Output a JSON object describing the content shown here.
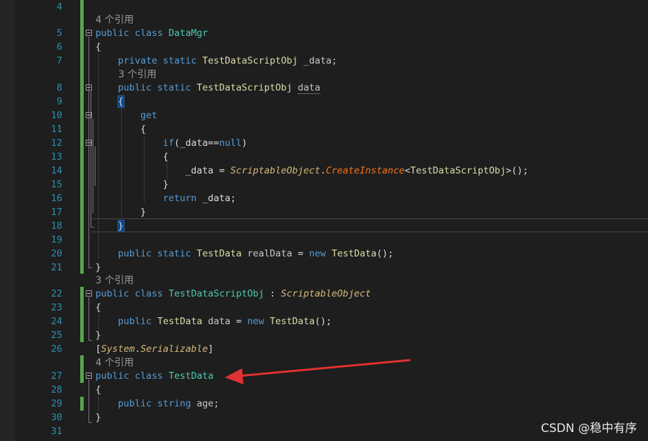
{
  "line_numbers": [
    "4",
    "5",
    "6",
    "7",
    "8",
    "9",
    "10",
    "11",
    "12",
    "13",
    "14",
    "15",
    "16",
    "17",
    "18",
    "19",
    "20",
    "21",
    "22",
    "23",
    "24",
    "25",
    "26",
    "27",
    "28",
    "29",
    "30",
    "31"
  ],
  "lens": {
    "refs_4": "4 个引用",
    "refs_3": "3 个引用"
  },
  "code": {
    "kw_public_class": "public class",
    "dataMgr": "DataMgr",
    "brace_open": "{",
    "brace_close": "}",
    "private_static": "private static",
    "public_static": "public static",
    "testDataScriptObj": "TestDataScriptObj",
    "field_data_decl": "_data;",
    "prop_data": "data",
    "get": "get",
    "if": "if",
    "if_cond_open": "(_data==",
    "null": "null",
    "if_cond_close": ")",
    "assign_data": "_data = ",
    "scriptableObject": "ScriptableObject",
    "dot": ".",
    "createInstance": "CreateInstance",
    "generic_open": "<",
    "generic_close": ">();",
    "return": "return",
    "return_val": "_data;",
    "testData": "TestData",
    "realData": "realData",
    "eq": " = ",
    "new": "new",
    "ctor_end": "();",
    "colon": " : ",
    "field_data": "data",
    "bracket_open": "[",
    "system": "System",
    "serializable": "Serializable",
    "bracket_close": "]",
    "string": "string",
    "age": "age;"
  },
  "watermark": "CSDN @稳中有序",
  "colors": {
    "keyword": "#569cd6",
    "class": "#4ec9b0",
    "type": "#dcdcaa",
    "line_number": "#2b91af",
    "annotation_arrow": "#e03232"
  }
}
